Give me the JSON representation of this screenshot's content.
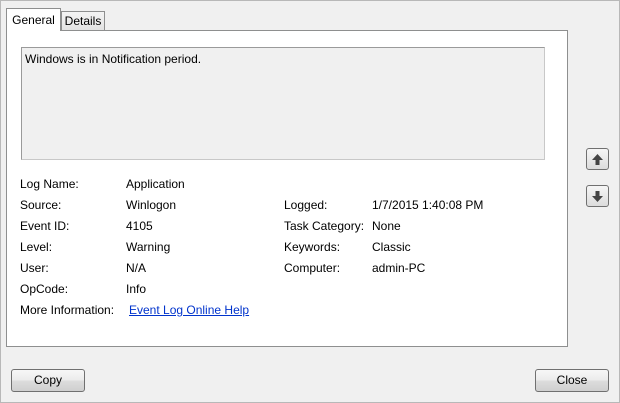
{
  "tabs": [
    {
      "label": "General",
      "active": true
    },
    {
      "label": "Details",
      "active": false
    }
  ],
  "message": "Windows is in Notification period.",
  "fields": {
    "log_name": {
      "label": "Log Name:",
      "value": "Application"
    },
    "source": {
      "label": "Source:",
      "value": "Winlogon"
    },
    "event_id": {
      "label": "Event ID:",
      "value": "4105"
    },
    "level": {
      "label": "Level:",
      "value": "Warning"
    },
    "user": {
      "label": "User:",
      "value": "N/A"
    },
    "opcode": {
      "label": "OpCode:",
      "value": "Info"
    },
    "more_info": {
      "label": "More Information:",
      "value": "Event Log Online Help"
    },
    "logged": {
      "label": "Logged:",
      "value": "1/7/2015 1:40:08 PM"
    },
    "task_category": {
      "label": "Task Category:",
      "value": "None"
    },
    "keywords": {
      "label": "Keywords:",
      "value": "Classic"
    },
    "computer": {
      "label": "Computer:",
      "value": "admin-PC"
    }
  },
  "buttons": {
    "copy": "Copy",
    "close": "Close"
  },
  "colors": {
    "link": "#0033cc",
    "arrow": "#444444"
  }
}
